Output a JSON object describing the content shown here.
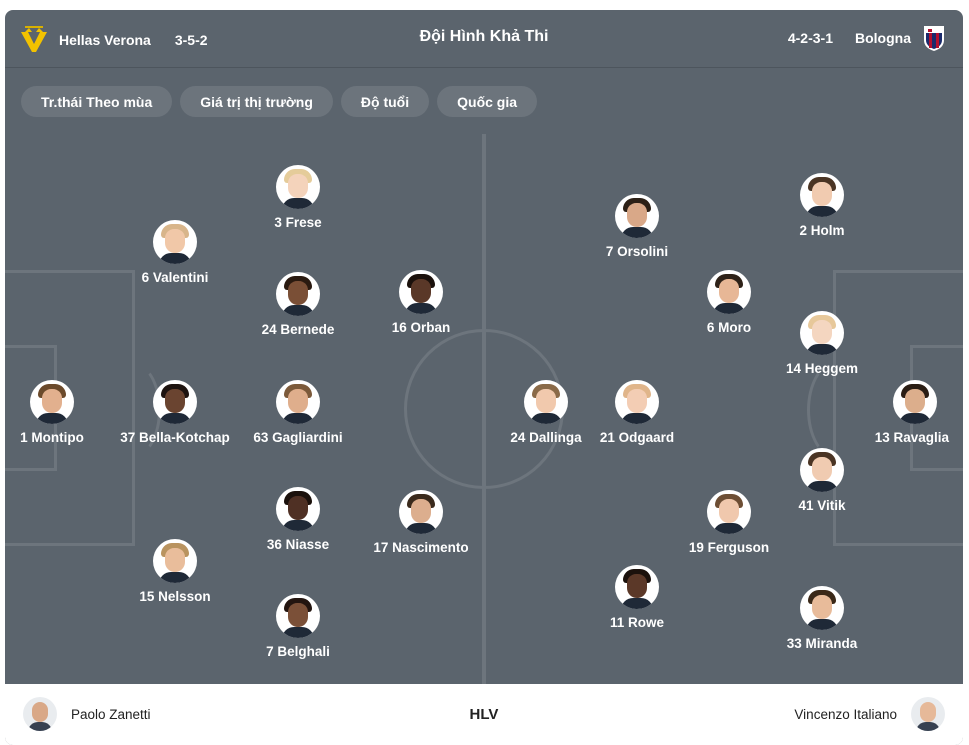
{
  "header": {
    "home": {
      "name": "Hellas Verona",
      "formation": "3-5-2",
      "logo": "verona-logo"
    },
    "title": "Đội Hình Khả Thi",
    "away": {
      "name": "Bologna",
      "formation": "4-2-3-1",
      "logo": "bologna-crest"
    }
  },
  "filters": [
    "Tr.thái Theo mùa",
    "Giá trị thị trường",
    "Độ tuổi",
    "Quốc gia"
  ],
  "players": [
    {
      "label": "1 Montipo",
      "skin": "#e2b08e",
      "hair": "#6b4a2b"
    },
    {
      "label": "6 Valentini",
      "skin": "#f1c8a8",
      "hair": "#d8b58a"
    },
    {
      "label": "37 Bella-Kotchap",
      "skin": "#6a4430",
      "hair": "#1e1410"
    },
    {
      "label": "15 Nelsson",
      "skin": "#e9bd9b",
      "hair": "#b9935f"
    },
    {
      "label": "3 Frese",
      "skin": "#f4d3bb",
      "hair": "#e5cc9a"
    },
    {
      "label": "24 Bernede",
      "skin": "#7a4f36",
      "hair": "#2a1a10"
    },
    {
      "label": "63 Gagliardini",
      "skin": "#dfae8c",
      "hair": "#7c5a3a"
    },
    {
      "label": "36 Niasse",
      "skin": "#4f3024",
      "hair": "#1b110c"
    },
    {
      "label": "7 Belghali",
      "skin": "#7b5038",
      "hair": "#231510"
    },
    {
      "label": "16 Orban",
      "skin": "#5a3828",
      "hair": "#1b110c"
    },
    {
      "label": "17 Nascimento",
      "skin": "#dcae8e",
      "hair": "#3a2a1c"
    },
    {
      "label": "24 Dallinga",
      "skin": "#f1c9ad",
      "hair": "#8a6a48"
    },
    {
      "label": "21 Odgaard",
      "skin": "#f3cdb4",
      "hair": "#e0b58a"
    },
    {
      "label": "7 Orsolini",
      "skin": "#d9a888",
      "hair": "#2c2016"
    },
    {
      "label": "11 Rowe",
      "skin": "#5b3828",
      "hair": "#1b110c"
    },
    {
      "label": "6 Moro",
      "skin": "#e7b796",
      "hair": "#2e2218"
    },
    {
      "label": "19 Ferguson",
      "skin": "#f0c8ad",
      "hair": "#6d4e34"
    },
    {
      "label": "2 Holm",
      "skin": "#f1cbb0",
      "hair": "#4b3524"
    },
    {
      "label": "14 Heggem",
      "skin": "#f4d6c0",
      "hair": "#e7c89a"
    },
    {
      "label": "41 Vitik",
      "skin": "#f0cbb1",
      "hair": "#4a3424"
    },
    {
      "label": "33 Miranda",
      "skin": "#e8bb9a",
      "hair": "#3a2818"
    },
    {
      "label": "13 Ravaglia",
      "skin": "#dcae8c",
      "hair": "#2a1d14"
    }
  ],
  "footer": {
    "home_coach": "Paolo Zanetti",
    "role": "HLV",
    "away_coach": "Vincenzo Italiano"
  }
}
